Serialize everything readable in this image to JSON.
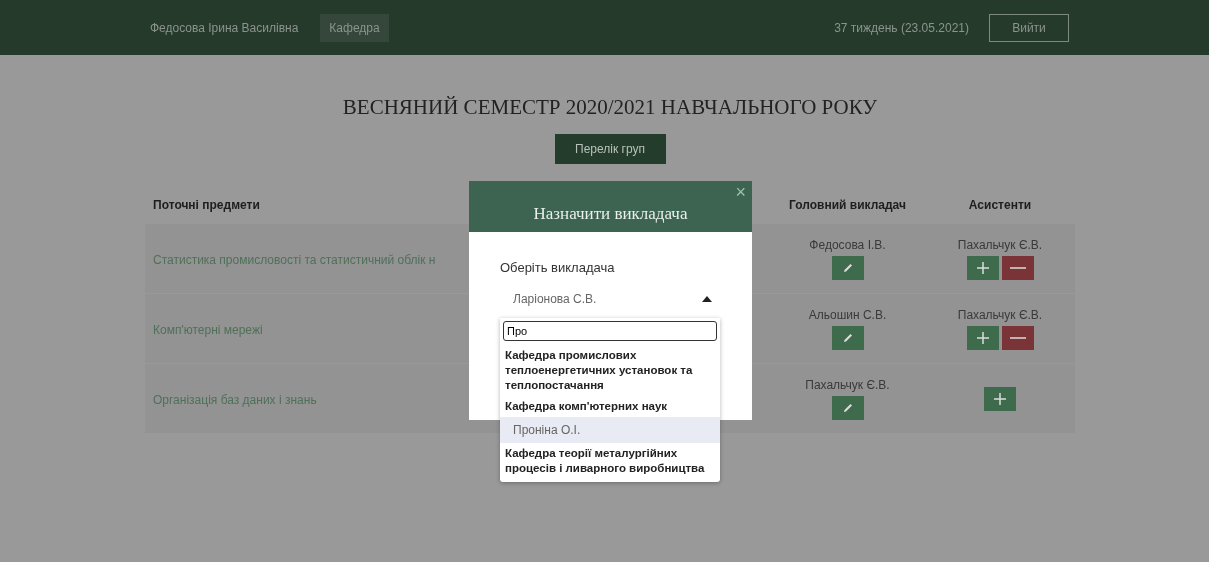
{
  "header": {
    "user_name": "Федосова Ірина Василівна",
    "nav": [
      {
        "label": "Кафедра",
        "selected": true
      }
    ],
    "week": "37 тиждень (23.05.2021)",
    "logout": "Вийти"
  },
  "title": "ВЕСНЯНИЙ СЕМЕСТР 2020/2021 НАВЧАЛЬНОГО РОКУ",
  "groups_button": "Перелік груп",
  "table": {
    "columns": [
      "Поточні предмети",
      "Головний викладач",
      "Асистенти"
    ],
    "rows": [
      {
        "subject": "Статистика промисловості та статистичний облік н",
        "main_teacher": "Федосова І.В.",
        "assistant": "Пахальчук Є.В.",
        "can_remove": true
      },
      {
        "subject": "Комп'ютерні мережі",
        "main_teacher": "Альошин С.В.",
        "assistant": "Пахальчук Є.В.",
        "can_remove": true
      },
      {
        "subject": "Організація баз даних і знань",
        "main_teacher": "Пахальчук Є.В.",
        "can_remove": false
      }
    ]
  },
  "modal": {
    "title": "Назначити викладача",
    "close": "×",
    "label": "Оберіть викладача",
    "select_value": "Ларіонова С.В.",
    "expanded": true,
    "search_value": "Про",
    "items": [
      {
        "kind": "group",
        "text": "Кафедра промислових теплоенергетичних установок та теплопостачання"
      },
      {
        "kind": "group",
        "text": "Кафедра комп'ютерних наук"
      },
      {
        "kind": "option",
        "text": "Проніна О.І.",
        "selected": true
      },
      {
        "kind": "group",
        "text": "Кафедра теорії металургійних процесів і ливарного виробництва"
      }
    ]
  }
}
